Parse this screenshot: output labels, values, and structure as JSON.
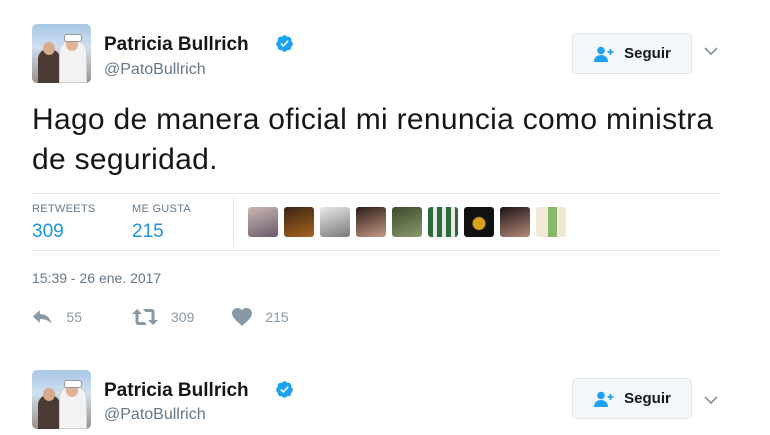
{
  "tweets": [
    {
      "author": {
        "name": "Patricia Bullrich",
        "handle": "@PatoBullrich",
        "verified": true,
        "verified_color": "#1da1f2"
      },
      "follow_label": "Seguir",
      "text": "Hago de manera oficial mi renuncia como ministra de seguridad.",
      "stats": {
        "retweets_label": "RETWEETS",
        "retweets": "309",
        "likes_label": "ME GUSTA",
        "likes": "215"
      },
      "likers_count": 9,
      "timestamp": "15:39 - 26 ene. 2017",
      "actions": {
        "reply_count": "55",
        "retweet_count": "309",
        "like_count": "215"
      }
    },
    {
      "author": {
        "name": "Patricia Bullrich",
        "handle": "@PatoBullrich",
        "verified": true,
        "verified_color": "#1da1f2"
      },
      "follow_label": "Seguir"
    }
  ],
  "colors": {
    "accent": "#1b95e0",
    "muted": "#657786",
    "icon": "#8899a6",
    "border": "#e1e8ed"
  },
  "icons": [
    "verified-badge-icon",
    "follow-user-icon",
    "chevron-down-icon",
    "reply-icon",
    "retweet-icon",
    "heart-icon"
  ]
}
